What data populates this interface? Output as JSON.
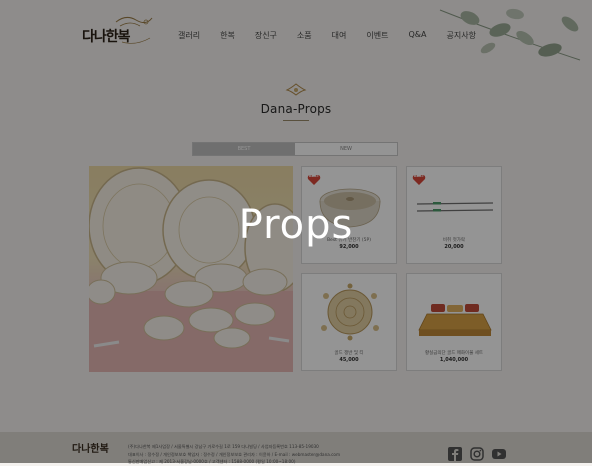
{
  "header": {
    "logo_text": "다나한복",
    "nav": [
      "갤러리",
      "한복",
      "장신구",
      "소품",
      "대여",
      "이벤트",
      "Q&A",
      "공지사항"
    ]
  },
  "brand": {
    "title": "Dana-Props"
  },
  "tabs": {
    "best": "BEST",
    "new": "NEW"
  },
  "products": [
    {
      "name": "Best 유기 반찬기 (5P)",
      "price": "92,000",
      "badge": "BEST"
    },
    {
      "name": "비취 젓가락",
      "price": "20,000",
      "badge": "BEST"
    },
    {
      "name": "골드 쟁반 및 티",
      "price": "45,000"
    },
    {
      "name": "황실금의단 골드 매화이불 세트",
      "price": "1,040,000"
    }
  ],
  "overlay": {
    "title": "Props"
  },
  "footer": {
    "logo_text": "다나한복",
    "lines": [
      "(주)다나한복 제1사업장 / 서울특별시 강남구 가로수길 1로 159 다나빌딩 / 사업자등록번호 113-85-19030",
      "대표이사 : 정수정 / 개인정보보호 책임자 : 정수정 / 개인정보보호 관리자 : 이윤하 / E-mail : webmaster@dana.com",
      "통신판매업신고 : 제 2013-서울강남-0000호 / 고객센터 : 1588-0000 (평일 10:00~18:00)"
    ]
  },
  "colors": {
    "overlay": "#000000",
    "accent": "#c9a96a",
    "badge": "#d8483a"
  },
  "icons": [
    "facebook-icon",
    "instagram-icon",
    "youtube-icon"
  ]
}
